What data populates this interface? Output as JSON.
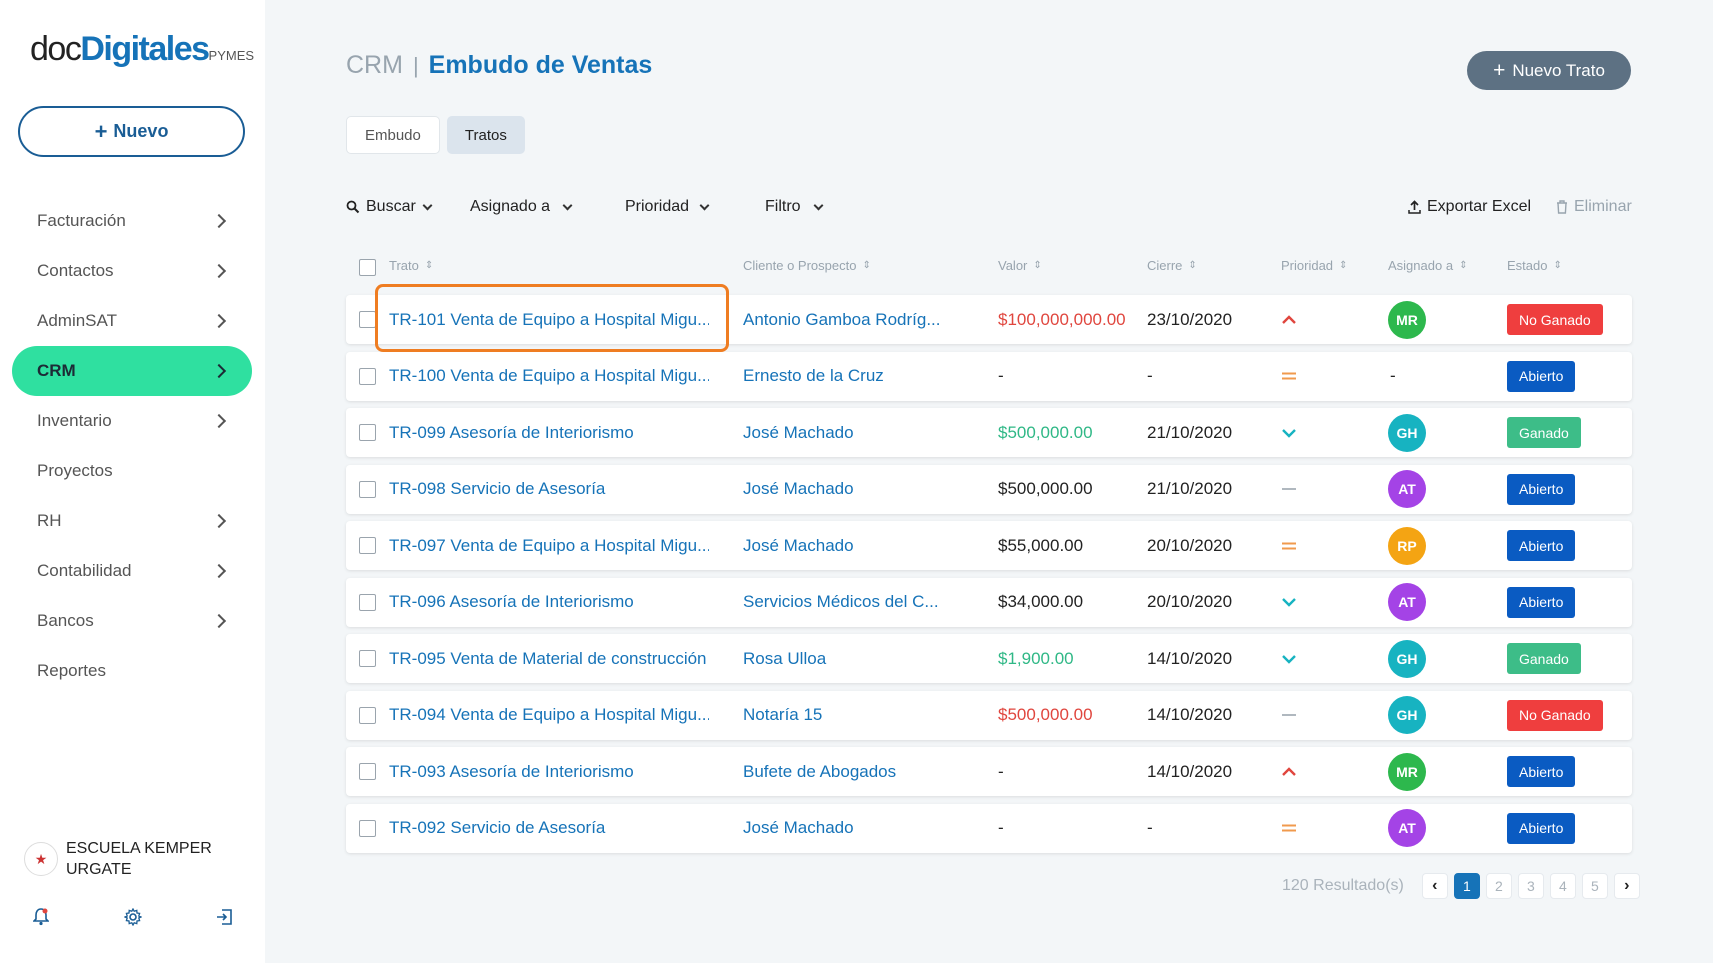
{
  "logo": {
    "part1": "doc",
    "part2": "Digitales",
    "part3": "PYMES"
  },
  "sidebar": {
    "new_button": "Nuevo",
    "items": [
      {
        "label": "Facturación",
        "chevron": true,
        "active": false
      },
      {
        "label": "Contactos",
        "chevron": true,
        "active": false
      },
      {
        "label": "AdminSAT",
        "chevron": true,
        "active": false
      },
      {
        "label": "CRM",
        "chevron": true,
        "active": true
      },
      {
        "label": "Inventario",
        "chevron": true,
        "active": false
      },
      {
        "label": "Proyectos",
        "chevron": false,
        "active": false
      },
      {
        "label": "RH",
        "chevron": true,
        "active": false
      },
      {
        "label": "Contabilidad",
        "chevron": true,
        "active": false
      },
      {
        "label": "Bancos",
        "chevron": true,
        "active": false
      },
      {
        "label": "Reportes",
        "chevron": false,
        "active": false
      }
    ],
    "company": "ESCUELA KEMPER URGATE",
    "icons": [
      "bell-icon",
      "gear-icon",
      "logout-icon"
    ]
  },
  "header": {
    "breadcrumb_root": "CRM",
    "separator": "|",
    "title": "Embudo de Ventas",
    "new_deal_button": "Nuevo Trato"
  },
  "tabs": [
    {
      "label": "Embudo",
      "active": false
    },
    {
      "label": "Tratos",
      "active": true
    }
  ],
  "toolbar": {
    "search": "Buscar",
    "assigned": "Asignado a",
    "priority": "Prioridad",
    "filter": "Filtro",
    "export": "Exportar Excel",
    "delete": "Eliminar"
  },
  "table": {
    "columns": [
      "Trato",
      "Cliente o Prospecto",
      "Valor",
      "Cierre",
      "Prioridad",
      "Asignado a",
      "Estado"
    ],
    "rows": [
      {
        "trato": "TR-101 Venta de Equipo a Hospital Migu...",
        "cliente": "Antonio Gamboa Rodríg...",
        "valor": "$100,000,000.00",
        "valor_color": "red",
        "cierre": "23/10/2020",
        "prioridad": "high",
        "asignado": "MR",
        "estado": "No Ganado"
      },
      {
        "trato": "TR-100 Venta de Equipo a Hospital Migu...",
        "cliente": "Ernesto de la Cruz",
        "valor": "-",
        "valor_color": "black",
        "cierre": "-",
        "prioridad": "medium",
        "asignado": "-",
        "estado": "Abierto"
      },
      {
        "trato": "TR-099 Asesoría de Interiorismo",
        "cliente": "José Machado",
        "valor": "$500,000.00",
        "valor_color": "green",
        "cierre": "21/10/2020",
        "prioridad": "low",
        "asignado": "GH",
        "estado": "Ganado"
      },
      {
        "trato": "TR-098 Servicio de Asesoría",
        "cliente": "José Machado",
        "valor": "$500,000.00",
        "valor_color": "black",
        "cierre": "21/10/2020",
        "prioridad": "none",
        "asignado": "AT",
        "estado": "Abierto"
      },
      {
        "trato": "TR-097 Venta de Equipo a Hospital Migu...",
        "cliente": "José Machado",
        "valor": "$55,000.00",
        "valor_color": "black",
        "cierre": "20/10/2020",
        "prioridad": "medium",
        "asignado": "RP",
        "estado": "Abierto"
      },
      {
        "trato": "TR-096 Asesoría de Interiorismo",
        "cliente": "Servicios Médicos del C...",
        "valor": "$34,000.00",
        "valor_color": "black",
        "cierre": "20/10/2020",
        "prioridad": "low",
        "asignado": "AT",
        "estado": "Abierto"
      },
      {
        "trato": "TR-095 Venta de Material de construcción",
        "cliente": "Rosa Ulloa",
        "valor": "$1,900.00",
        "valor_color": "green",
        "cierre": "14/10/2020",
        "prioridad": "low",
        "asignado": "GH",
        "estado": "Ganado"
      },
      {
        "trato": "TR-094 Venta de Equipo a Hospital Migu...",
        "cliente": "Notaría 15",
        "valor": "$500,000.00",
        "valor_color": "red",
        "cierre": "14/10/2020",
        "prioridad": "none",
        "asignado": "GH",
        "estado": "No Ganado"
      },
      {
        "trato": "TR-093 Asesoría de Interiorismo",
        "cliente": "Bufete de Abogados",
        "valor": "-",
        "valor_color": "black",
        "cierre": "14/10/2020",
        "prioridad": "high",
        "asignado": "MR",
        "estado": "Abierto"
      },
      {
        "trato": "TR-092 Servicio de Asesoría",
        "cliente": "José Machado",
        "valor": "-",
        "valor_color": "black",
        "cierre": "-",
        "prioridad": "medium",
        "asignado": "AT",
        "estado": "Abierto"
      }
    ]
  },
  "avatar_colors": {
    "MR": "#2db84d",
    "GH": "#17b3c1",
    "AT": "#a443e6",
    "RP": "#f4a413"
  },
  "status_colors": {
    "No Ganado": "#ef3e3e",
    "Abierto": "#0a5bc2",
    "Ganado": "#3dbd88"
  },
  "priority_colors": {
    "high": "#e0463e",
    "medium": "#f09a4d",
    "low": "#17b3c1",
    "none": "#b0b8bf"
  },
  "pagination": {
    "results": "120 Resultado(s)",
    "pages": [
      "1",
      "2",
      "3",
      "4",
      "5"
    ],
    "current": "1"
  }
}
